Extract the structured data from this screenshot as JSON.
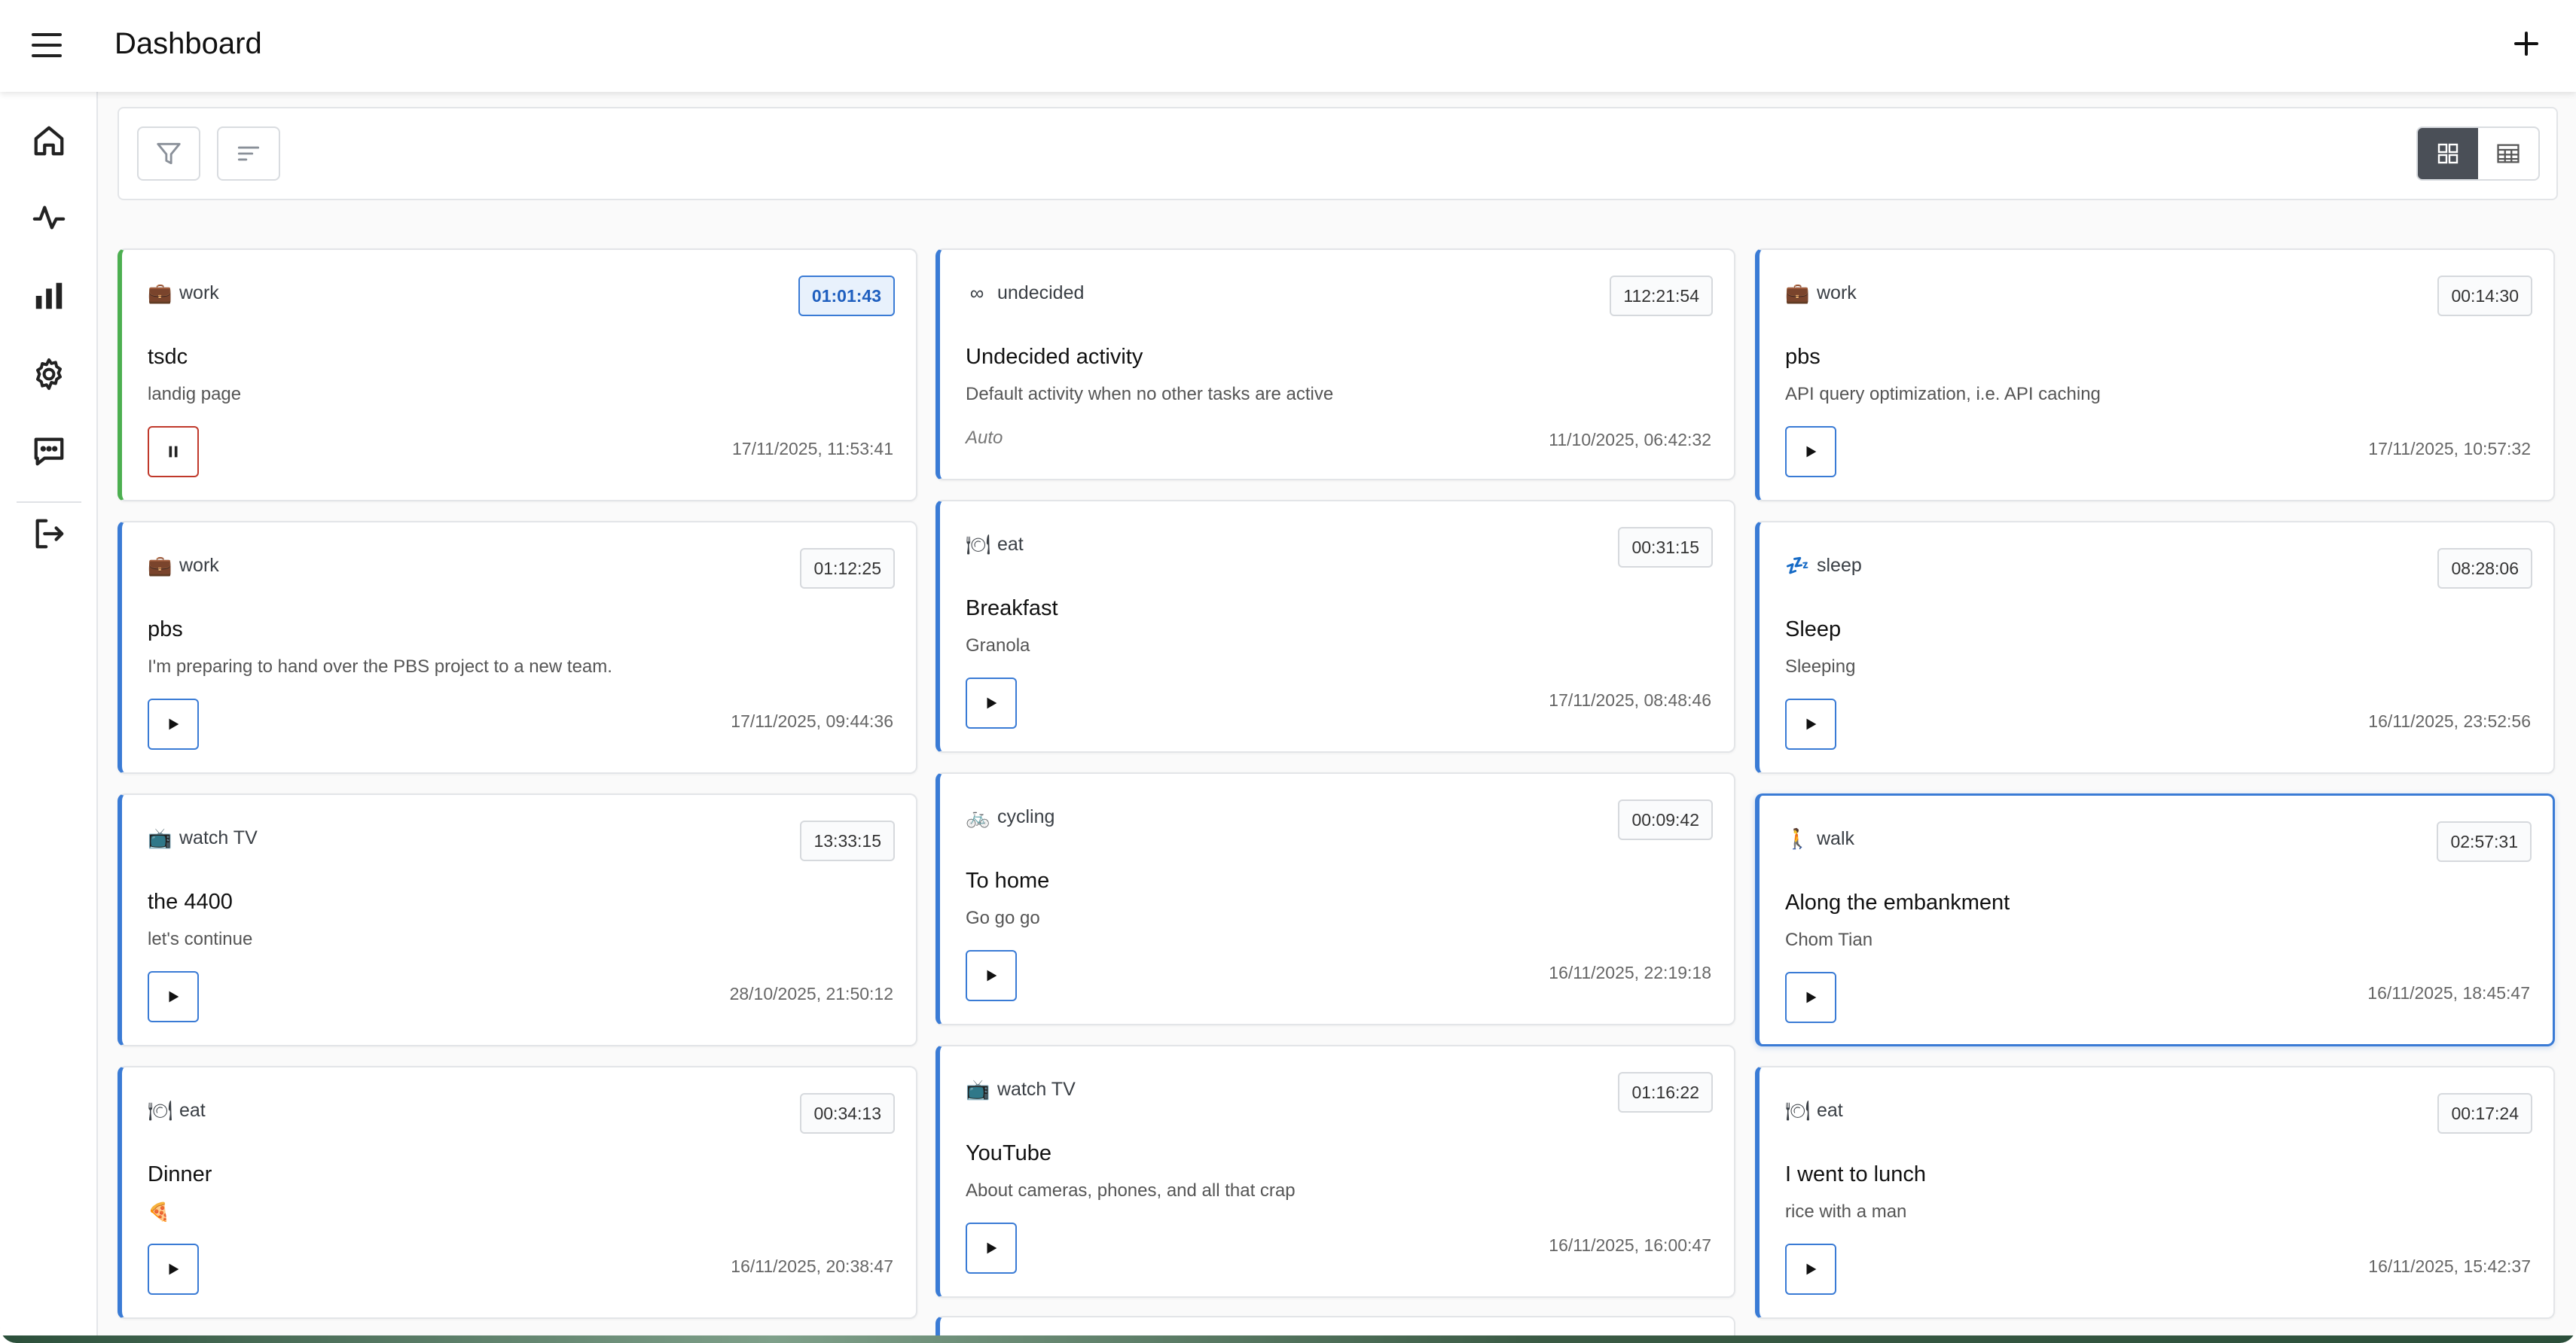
{
  "header": {
    "title": "Dashboard"
  },
  "sidebar": {
    "items": [
      {
        "icon": "home-icon"
      },
      {
        "icon": "activity-icon"
      },
      {
        "icon": "bar-chart-icon"
      },
      {
        "icon": "gear-icon"
      },
      {
        "icon": "message-icon"
      },
      {
        "icon": "logout-icon"
      }
    ]
  },
  "toolbar": {
    "filter_icon": "filter-icon",
    "sort_icon": "sort-icon",
    "views": [
      "grid-view",
      "table-view"
    ],
    "active_view": "grid-view"
  },
  "colors": {
    "accent": "#3a7bd5",
    "running": "#4caf50",
    "pause": "#c0392b",
    "active_view_bg": "#4a4f57"
  },
  "cards": [
    {
      "category": "work",
      "icon": "💼",
      "timer": "01:01:43",
      "title": "tsdc",
      "desc": "landig page",
      "stamp": "17/11/2025, 11:53:41",
      "state": "running"
    },
    {
      "category": "undecided",
      "icon": "∞",
      "timer": "112:21:54",
      "title": "Undecided activity",
      "desc": "Default activity when no other tasks are active",
      "auto_label": "Auto",
      "stamp": "11/10/2025, 06:42:32",
      "state": "auto"
    },
    {
      "category": "work",
      "icon": "💼",
      "timer": "00:14:30",
      "title": "pbs",
      "desc": "API query optimization, i.e. API caching",
      "stamp": "17/11/2025, 10:57:32",
      "state": "idle"
    },
    {
      "category": "work",
      "icon": "💼",
      "timer": "01:12:25",
      "title": "pbs",
      "desc": "I'm preparing to hand over the PBS project to a new team.",
      "stamp": "17/11/2025, 09:44:36",
      "state": "idle"
    },
    {
      "category": "eat",
      "icon": "🍽",
      "timer": "00:31:15",
      "title": "Breakfast",
      "desc": "Granola",
      "stamp": "17/11/2025, 08:48:46",
      "state": "idle"
    },
    {
      "category": "sleep",
      "icon": "💤",
      "timer": "08:28:06",
      "title": "Sleep",
      "desc": "Sleeping",
      "stamp": "16/11/2025, 23:52:56",
      "state": "idle"
    },
    {
      "category": "watch TV",
      "icon": "📺",
      "timer": "13:33:15",
      "title": "the 4400",
      "desc": "let's continue",
      "stamp": "28/10/2025, 21:50:12",
      "state": "idle"
    },
    {
      "category": "cycling",
      "icon": "🚲",
      "timer": "00:09:42",
      "title": "To home",
      "desc": "Go go go",
      "stamp": "16/11/2025, 22:19:18",
      "state": "idle"
    },
    {
      "category": "walk",
      "icon": "🚶",
      "timer": "02:57:31",
      "title": "Along the embankment",
      "desc": "Chom Tian",
      "stamp": "16/11/2025, 18:45:47",
      "state": "selected"
    },
    {
      "category": "eat",
      "icon": "🍽",
      "timer": "00:34:13",
      "title": "Dinner",
      "desc": "🍕",
      "stamp": "16/11/2025, 20:38:47",
      "state": "idle"
    },
    {
      "category": "watch TV",
      "icon": "📺",
      "timer": "01:16:22",
      "title": "YouTube",
      "desc": "About cameras, phones, and all that crap",
      "stamp": "16/11/2025, 16:00:47",
      "state": "idle"
    },
    {
      "category": "eat",
      "icon": "🍽",
      "timer": "00:17:24",
      "title": "I went to lunch",
      "desc": "rice with a man",
      "stamp": "16/11/2025, 15:42:37",
      "state": "idle"
    }
  ]
}
